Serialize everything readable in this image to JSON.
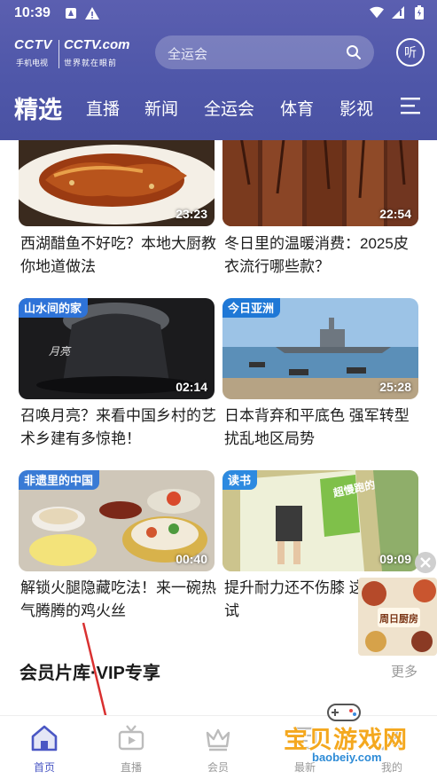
{
  "status_bar": {
    "time": "10:39"
  },
  "brand": {
    "cctv": "CCTV",
    "sub_left": "手机电视",
    "cctv_com": "CCTV.com",
    "sub_right": "世界就在眼前"
  },
  "search": {
    "placeholder": "全运会"
  },
  "listen_button": {
    "label": "听"
  },
  "tabs": [
    {
      "label": "精选",
      "active": true
    },
    {
      "label": "直播"
    },
    {
      "label": "新闻"
    },
    {
      "label": "全运会"
    },
    {
      "label": "体育"
    },
    {
      "label": "影视"
    }
  ],
  "feed": [
    {
      "duration": "23:23",
      "title": "西湖醋鱼不好吃？本地大厨教你地道做法",
      "tag": ""
    },
    {
      "duration": "22:54",
      "title": "冬日里的温暖消费：2025皮衣流行哪些款？",
      "tag": ""
    },
    {
      "duration": "02:14",
      "title": "召唤月亮？来看中国乡村的艺术乡建有多惊艳！",
      "tag": "山水间的家",
      "overlay": "月亮"
    },
    {
      "duration": "25:28",
      "title": "日本背弃和平底色 强军转型扰乱地区局势",
      "tag": "今日亚洲"
    },
    {
      "duration": "00:40",
      "title": "解锁火腿隐藏吃法！来一碗热气腾腾的鸡火丝",
      "tag": "非遗里的中国"
    },
    {
      "duration": "09:09",
      "title": "提升耐力还不伤膝 这值得一试",
      "tag": "读书",
      "overlay": "超慢跑的"
    }
  ],
  "vip_section": {
    "title": "会员片库·VIP专享",
    "more": "更多"
  },
  "float_ad": {
    "text": "周日厨房"
  },
  "bottom_nav": [
    {
      "label": "首页",
      "active": true
    },
    {
      "label": "直播"
    },
    {
      "label": "会员"
    },
    {
      "label": "最新"
    },
    {
      "label": "我的"
    }
  ],
  "watermark": {
    "text": "宝贝游戏网",
    "url": "baobeiy.com"
  },
  "colors": {
    "header": "#4f57a9",
    "active_nav": "#4a57c4",
    "watermark": "#f4a81f"
  }
}
